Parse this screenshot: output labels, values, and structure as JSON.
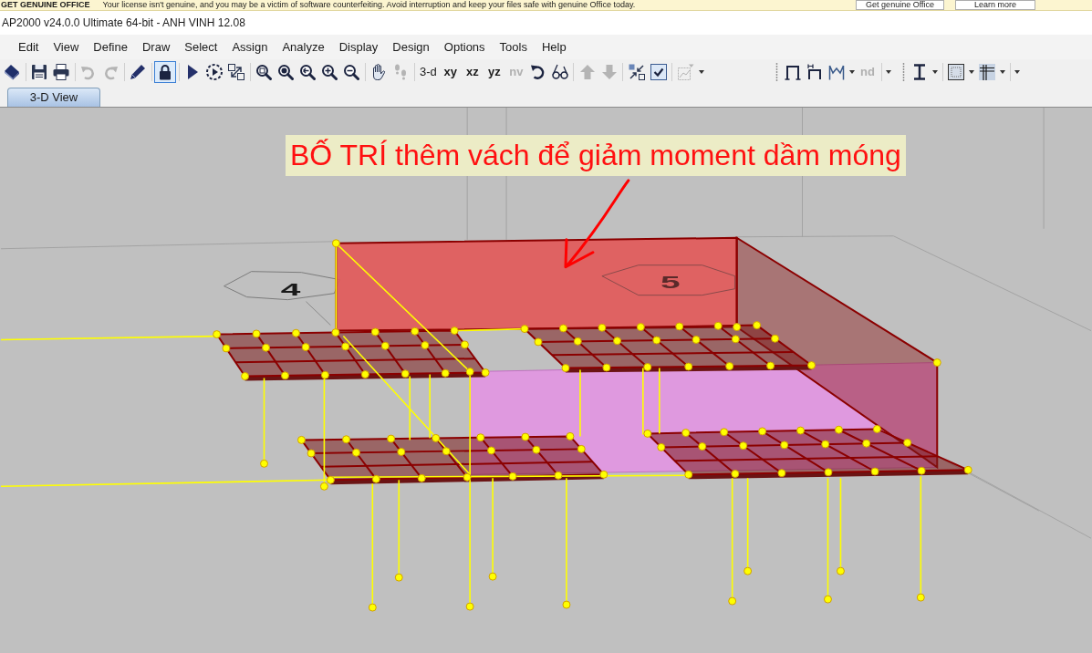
{
  "notification_bar": {
    "title": "GET GENUINE OFFICE",
    "message": "Your license isn't genuine, and you may be a victim of software counterfeiting. Avoid interruption and keep your files safe with genuine Office today.",
    "buttons": [
      "Get genuine Office",
      "Learn more"
    ]
  },
  "window": {
    "title": "AP2000 v24.0.0 Ultimate 64-bit - ANH VINH 12.08"
  },
  "menu": [
    "Edit",
    "View",
    "Define",
    "Draw",
    "Select",
    "Assign",
    "Analyze",
    "Display",
    "Design",
    "Options",
    "Tools",
    "Help"
  ],
  "toolbars": [
    {
      "groups": [
        [
          {
            "kind": "icon",
            "disabled": false,
            "on": false
          }
        ],
        [
          {
            "kind": "icon",
            "disabled": false,
            "on": false
          },
          {
            "kind": "icon",
            "disabled": false,
            "on": false
          }
        ],
        [
          {
            "kind": "icon",
            "disabled": true,
            "on": false
          },
          {
            "kind": "icon",
            "disabled": true,
            "on": false
          }
        ],
        [
          {
            "kind": "icon",
            "disabled": false,
            "on": false
          }
        ],
        [
          {
            "kind": "icon",
            "disabled": false,
            "on": true
          }
        ],
        [
          {
            "kind": "icon",
            "disabled": false,
            "on": false
          },
          {
            "kind": "icon",
            "disabled": false,
            "on": false
          },
          {
            "kind": "icon",
            "disabled": false,
            "on": false
          }
        ],
        [
          {
            "kind": "icon",
            "disabled": false,
            "on": false
          },
          {
            "kind": "icon",
            "disabled": false,
            "on": false
          },
          {
            "kind": "icon",
            "disabled": false,
            "on": false
          },
          {
            "kind": "icon",
            "disabled": false,
            "on": false
          },
          {
            "kind": "icon",
            "disabled": false,
            "on": false
          }
        ],
        [
          {
            "kind": "icon",
            "disabled": false,
            "on": false
          },
          {
            "kind": "icon",
            "disabled": true,
            "on": false
          }
        ],
        [
          {
            "kind": "text",
            "label": "3-d",
            "disabled": false,
            "on": false
          },
          {
            "kind": "bold_text",
            "label": "xy",
            "disabled": false,
            "on": false
          },
          {
            "kind": "bold_text",
            "label": "xz",
            "disabled": false,
            "on": false
          },
          {
            "kind": "bold_text",
            "label": "yz",
            "disabled": false,
            "on": false
          },
          {
            "kind": "bold_text",
            "label": "nv",
            "disabled": true,
            "on": false
          },
          {
            "kind": "icon",
            "disabled": false,
            "on": false
          },
          {
            "kind": "icon",
            "disabled": false,
            "on": false
          }
        ],
        [
          {
            "kind": "icon",
            "disabled": true,
            "on": false
          },
          {
            "kind": "icon",
            "disabled": true,
            "on": false
          }
        ],
        [
          {
            "kind": "icon",
            "disabled": false,
            "on": false
          },
          {
            "kind": "icon",
            "disabled": false,
            "on": false
          }
        ],
        [
          {
            "kind": "icon",
            "disabled": true,
            "on": false
          },
          {
            "kind": "dropdown",
            "disabled": false,
            "on": false
          }
        ]
      ]
    },
    {
      "groups": [
        [
          {
            "kind": "icon",
            "disabled": false,
            "on": false
          },
          {
            "kind": "icon",
            "disabled": false,
            "on": false
          },
          {
            "kind": "icon",
            "disabled": false,
            "on": false
          },
          {
            "kind": "dropdown",
            "disabled": false,
            "on": false
          },
          {
            "kind": "bold_text",
            "label": "nd",
            "disabled": true,
            "on": false
          }
        ],
        [
          {
            "kind": "dropdown",
            "disabled": false,
            "on": false
          }
        ]
      ]
    },
    {
      "groups": [
        [
          {
            "kind": "icon",
            "disabled": false,
            "on": false
          },
          {
            "kind": "dropdown",
            "disabled": false,
            "on": false
          }
        ],
        [
          {
            "kind": "icon",
            "disabled": false,
            "on": false
          },
          {
            "kind": "dropdown",
            "disabled": false,
            "on": false
          },
          {
            "kind": "icon",
            "disabled": false,
            "on": false
          },
          {
            "kind": "dropdown",
            "disabled": false,
            "on": false
          }
        ],
        [
          {
            "kind": "dropdown",
            "disabled": false,
            "on": false
          }
        ]
      ]
    }
  ],
  "tabs": [
    {
      "label": "3-D View",
      "selected": true
    }
  ],
  "viewport": {
    "grid_bubbles": [
      {
        "label": "4"
      },
      {
        "label": "5"
      }
    ],
    "annotation": {
      "text": "BỐ TRÍ thêm vách để giảm moment dầm móng"
    }
  }
}
